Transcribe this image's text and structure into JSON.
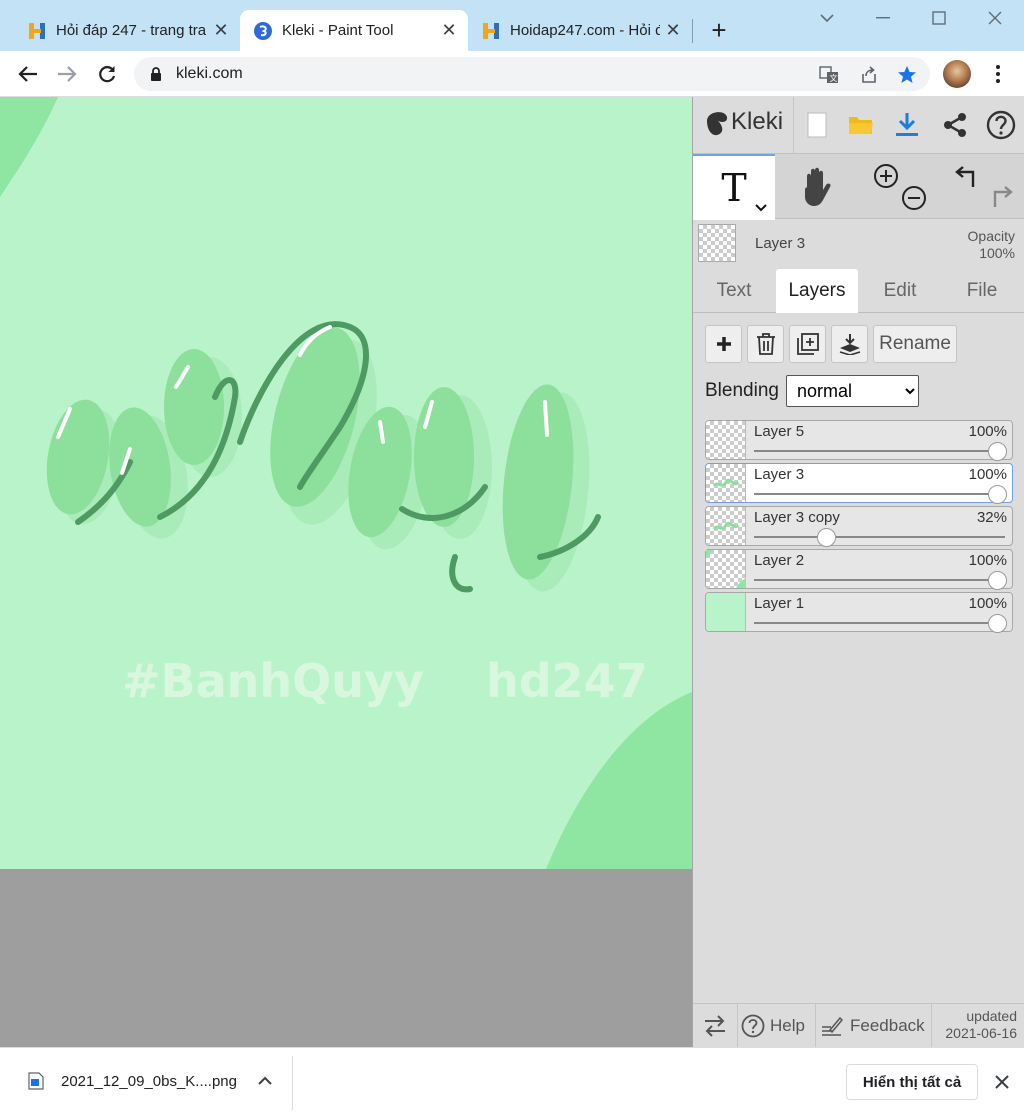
{
  "browser": {
    "tabs": [
      {
        "title": "Hỏi đáp 247 - trang tra",
        "active": false
      },
      {
        "title": "Kleki - Paint Tool",
        "active": true
      },
      {
        "title": "Hoidap247.com - Hỏi đ",
        "active": false
      }
    ],
    "new_tab_label": "+",
    "url": "kleki.com"
  },
  "artwork": {
    "lettering": "why",
    "hashtag": "#BanhQuyy",
    "watermark": "hd247",
    "background_color": "#b9f3c9",
    "letter_color": "#8ddf9c",
    "accent_color": "#4f9a63"
  },
  "kleki": {
    "logo": "Kleki",
    "current_layer": {
      "name": "Layer 3",
      "opacity_label": "Opacity",
      "opacity_value": "100%"
    },
    "tool_text_glyph": "T",
    "tabs": [
      "Text",
      "Layers",
      "Edit",
      "File"
    ],
    "active_tab": "Layers",
    "layer_buttons": {
      "rename": "Rename"
    },
    "blending": {
      "label": "Blending",
      "value": "normal",
      "options": [
        "normal"
      ]
    },
    "layers": [
      {
        "name": "Layer 5",
        "opacity": "100%",
        "level": 1.0,
        "selected": false,
        "thumb": "empty"
      },
      {
        "name": "Layer 3",
        "opacity": "100%",
        "level": 1.0,
        "selected": true,
        "thumb": "text"
      },
      {
        "name": "Layer 3 copy",
        "opacity": "32%",
        "level": 0.32,
        "selected": false,
        "thumb": "text"
      },
      {
        "name": "Layer 2",
        "opacity": "100%",
        "level": 1.0,
        "selected": false,
        "thumb": "corner"
      },
      {
        "name": "Layer 1",
        "opacity": "100%",
        "level": 1.0,
        "selected": false,
        "thumb": "fill"
      }
    ],
    "footer": {
      "help": "Help",
      "feedback": "Feedback",
      "updated_label": "updated",
      "updated_date": "2021-06-16"
    }
  },
  "downloads": {
    "file_name": "2021_12_09_0bs_K....png",
    "show_all": "Hiển thị tất cả"
  }
}
